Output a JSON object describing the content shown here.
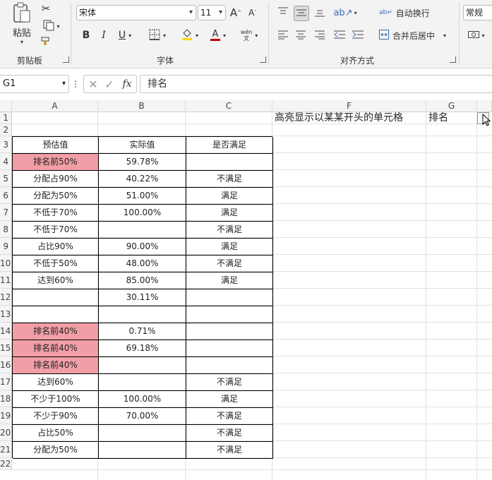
{
  "ribbon": {
    "clipboard": {
      "paste_label": "粘贴",
      "group_label": "剪贴板"
    },
    "font": {
      "font_name": "宋体",
      "font_size": "11",
      "group_label": "字体"
    },
    "alignment": {
      "wrap_text_label": "自动换行",
      "merge_center_label": "合并后居中",
      "group_label": "对齐方式"
    },
    "number": {
      "format": "常规"
    }
  },
  "formula_bar": {
    "name_box": "G1",
    "fx_label": "fx",
    "formula": "排名"
  },
  "columns": [
    "A",
    "B",
    "C",
    "F",
    "G"
  ],
  "row_numbers": [
    "1",
    "2",
    "3",
    "4",
    "5",
    "6",
    "7",
    "8",
    "9",
    "10",
    "11",
    "12",
    "13",
    "14",
    "15",
    "16",
    "17",
    "18",
    "19",
    "20",
    "21",
    "22"
  ],
  "cells": {
    "F1": "高亮显示以某某开头的单元格",
    "G1": "排名"
  },
  "table": {
    "headers": [
      "预估值",
      "实际值",
      "是否满足"
    ],
    "rows": [
      {
        "a": "排名前50%",
        "b": "59.78%",
        "c": "",
        "highlight": true
      },
      {
        "a": "分配占90%",
        "b": "40.22%",
        "c": "不满足",
        "highlight": false
      },
      {
        "a": "分配为50%",
        "b": "51.00%",
        "c": "满足",
        "highlight": false
      },
      {
        "a": "不低于70%",
        "b": "100.00%",
        "c": "满足",
        "highlight": false
      },
      {
        "a": "不低于70%",
        "b": "",
        "c": "不满足",
        "highlight": false
      },
      {
        "a": "占比90%",
        "b": "90.00%",
        "c": "满足",
        "highlight": false
      },
      {
        "a": "不低于50%",
        "b": "48.00%",
        "c": "不满足",
        "highlight": false
      },
      {
        "a": "达到60%",
        "b": "85.00%",
        "c": "满足",
        "highlight": false
      },
      {
        "a": "",
        "b": "30.11%",
        "c": "",
        "highlight": false
      },
      {
        "a": "",
        "b": "",
        "c": "",
        "highlight": false
      },
      {
        "a": "排名前40%",
        "b": "0.71%",
        "c": "",
        "highlight": true
      },
      {
        "a": "排名前40%",
        "b": "69.18%",
        "c": "",
        "highlight": true
      },
      {
        "a": "排名前40%",
        "b": "",
        "c": "",
        "highlight": true
      },
      {
        "a": "达到60%",
        "b": "",
        "c": "不满足",
        "highlight": false
      },
      {
        "a": "不少于100%",
        "b": "100.00%",
        "c": "满足",
        "highlight": false
      },
      {
        "a": "不少于90%",
        "b": "70.00%",
        "c": "不满足",
        "highlight": false
      },
      {
        "a": "占比50%",
        "b": "",
        "c": "不满足",
        "highlight": false
      },
      {
        "a": "分配为50%",
        "b": "",
        "c": "不满足",
        "highlight": false
      }
    ]
  },
  "colors": {
    "highlight": "#f19ea6",
    "font_color_bar": "#c00000",
    "fill_color_bar": "#ffd700"
  }
}
